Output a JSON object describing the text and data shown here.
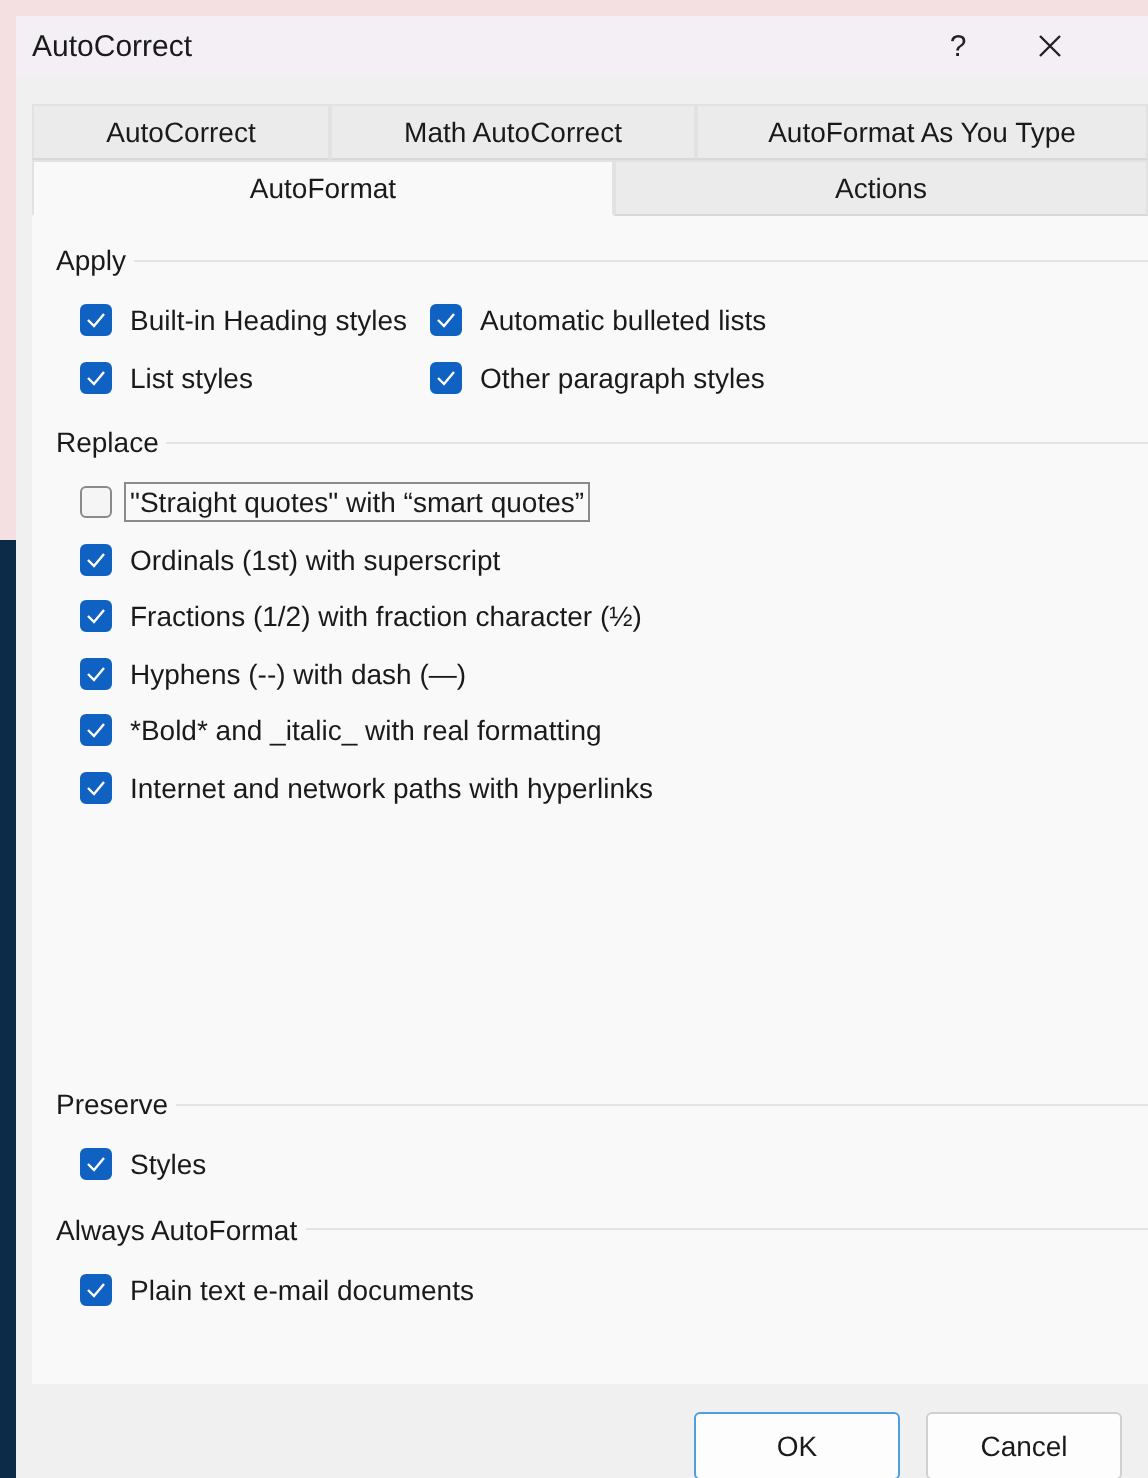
{
  "window": {
    "title": "AutoCorrect",
    "help": "?"
  },
  "tab_rows": [
    [
      {
        "label": "AutoCorrect",
        "selected": false
      },
      {
        "label": "Math AutoCorrect",
        "selected": false
      },
      {
        "label": "AutoFormat As You Type",
        "selected": false
      }
    ],
    [
      {
        "label": "AutoFormat",
        "selected": true
      },
      {
        "label": "Actions",
        "selected": false
      }
    ]
  ],
  "sections": [
    {
      "title": "Apply",
      "options": [
        {
          "label": "Built-in Heading styles",
          "checked": true,
          "focused": false
        },
        {
          "label": "Automatic bulleted lists",
          "checked": true,
          "focused": false
        },
        {
          "label": "List styles",
          "checked": true,
          "focused": false
        },
        {
          "label": "Other paragraph styles",
          "checked": true,
          "focused": false
        }
      ]
    },
    {
      "title": "Replace",
      "options": [
        {
          "label": "\"Straight quotes\" with “smart quotes”",
          "checked": false,
          "focused": true
        },
        {
          "label": "Ordinals (1st) with superscript",
          "checked": true,
          "focused": false
        },
        {
          "label": "Fractions (1/2) with fraction character (½)",
          "checked": true,
          "focused": false
        },
        {
          "label": "Hyphens (--) with dash (—)",
          "checked": true,
          "focused": false
        },
        {
          "label": "*Bold* and _italic_ with real formatting",
          "checked": true,
          "focused": false
        },
        {
          "label": "Internet and network paths with hyperlinks",
          "checked": true,
          "focused": false
        }
      ]
    },
    {
      "title": "Preserve",
      "options": [
        {
          "label": "Styles",
          "checked": true,
          "focused": false
        }
      ]
    },
    {
      "title": "Always AutoFormat",
      "options": [
        {
          "label": "Plain text e-mail documents",
          "checked": true,
          "focused": false
        }
      ]
    }
  ],
  "buttons": [
    {
      "label": "OK",
      "default": true
    },
    {
      "label": "Cancel",
      "default": false
    }
  ]
}
